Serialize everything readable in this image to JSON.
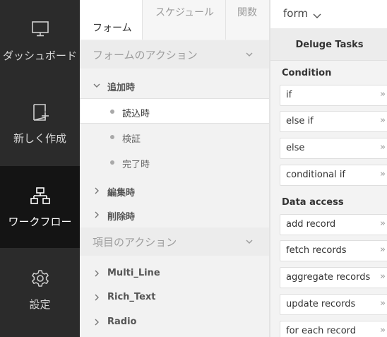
{
  "nav": {
    "items": [
      {
        "label": "ダッシュボード",
        "icon": "monitor-icon"
      },
      {
        "label": "新しく作成",
        "icon": "new-page-icon"
      },
      {
        "label": "ワークフロー",
        "icon": "workflow-icon",
        "active": true
      },
      {
        "label": "設定",
        "icon": "gear-icon"
      }
    ]
  },
  "tabs": {
    "items": [
      {
        "label": "フォーム"
      },
      {
        "label": "スケジュール"
      },
      {
        "label": "関数"
      }
    ]
  },
  "form_actions": {
    "title": "フォームのアクション",
    "on_add": {
      "label": "追加時",
      "children": [
        "読込時",
        "検証",
        "完了時"
      ]
    },
    "on_edit": "編集時",
    "on_delete": "削除時"
  },
  "field_actions": {
    "title": "項目のアクション",
    "items": [
      "Multi_Line",
      "Rich_Text",
      "Radio"
    ]
  },
  "right": {
    "form_select": "form",
    "header": "Deluge Tasks",
    "condition": {
      "title": "Condition",
      "items": [
        "if",
        "else if",
        "else",
        "conditional if"
      ]
    },
    "data_access": {
      "title": "Data access",
      "items": [
        "add record",
        "fetch records",
        "aggregate records",
        "update records",
        "for each record"
      ]
    }
  },
  "colors": {
    "nav_bg": "#2b2b2b",
    "nav_active_bg": "#141414",
    "panel_bg": "#f2f2f2",
    "selected_bg": "#ffffff"
  }
}
